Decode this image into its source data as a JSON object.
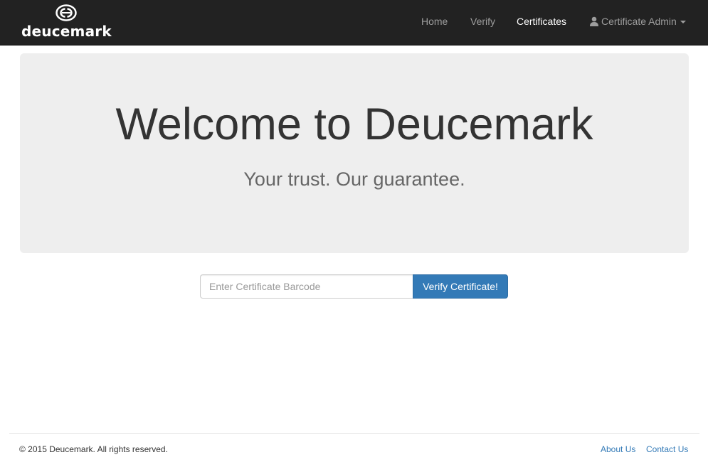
{
  "brand": {
    "name": "deucemark",
    "logo_icon": "deucemark-logo-icon"
  },
  "nav": {
    "items": [
      {
        "label": "Home",
        "active": false
      },
      {
        "label": "Verify",
        "active": false
      },
      {
        "label": "Certificates",
        "active": true
      }
    ],
    "user_menu": {
      "icon": "user-icon",
      "label": "Certificate Admin"
    }
  },
  "hero": {
    "title": "Welcome to Deucemark",
    "subtitle": "Your trust. Our guarantee."
  },
  "verify_form": {
    "placeholder": "Enter Certificate Barcode",
    "value": "",
    "button_label": "Verify Certificate!"
  },
  "footer": {
    "copyright": "© 2015 Deucemark. All rights reserved.",
    "links": [
      {
        "label": "About Us"
      },
      {
        "label": "Contact Us"
      }
    ]
  },
  "colors": {
    "navbar_bg": "#222222",
    "accent": "#337ab7",
    "jumbotron_bg": "#eeeeee"
  }
}
